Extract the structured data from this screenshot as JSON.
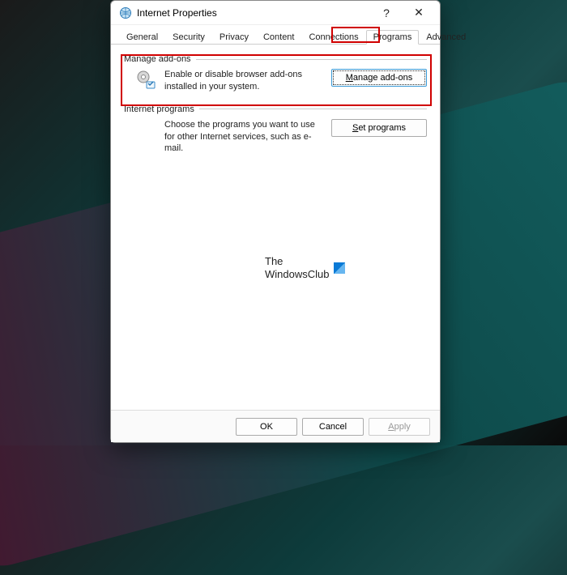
{
  "window": {
    "title": "Internet Properties",
    "help_symbol": "?",
    "close_symbol": "✕"
  },
  "tabs": [
    {
      "label": "General",
      "active": false
    },
    {
      "label": "Security",
      "active": false
    },
    {
      "label": "Privacy",
      "active": false
    },
    {
      "label": "Content",
      "active": false
    },
    {
      "label": "Connections",
      "active": false
    },
    {
      "label": "Programs",
      "active": true
    },
    {
      "label": "Advanced",
      "active": false
    }
  ],
  "sections": {
    "manage_addons": {
      "title": "Manage add-ons",
      "description": "Enable or disable browser add-ons installed in your system.",
      "button_label": "Manage add-ons",
      "button_mnemonic": "M"
    },
    "internet_programs": {
      "title": "Internet programs",
      "description": "Choose the programs you want to use for other Internet services, such as e-mail.",
      "button_label": "Set programs",
      "button_mnemonic": "S"
    }
  },
  "watermark": {
    "line1": "The",
    "line2": "WindowsClub"
  },
  "buttons": {
    "ok": "OK",
    "cancel": "Cancel",
    "apply": "Apply"
  }
}
